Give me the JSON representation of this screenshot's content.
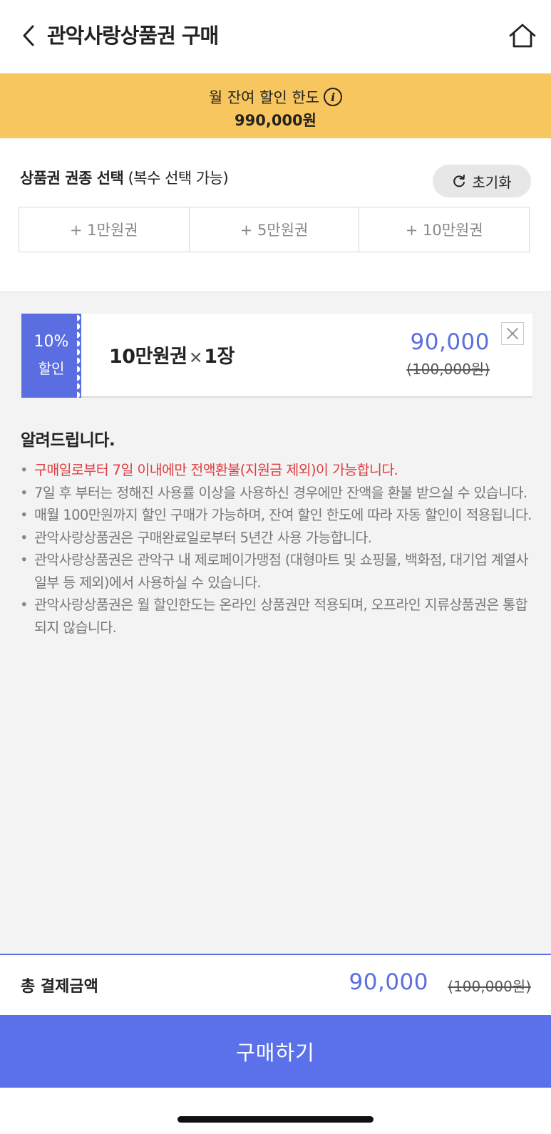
{
  "header": {
    "title": "관악사랑상품권 구매"
  },
  "limit_banner": {
    "label": "월 잔여 할인 한도",
    "amount": "990,000원"
  },
  "voucher_select": {
    "title": "상품권 권종 선택",
    "subtitle": "(복수 선택 가능)",
    "reset_label": "초기화",
    "options": [
      "+ 1만원권",
      "+ 5만원권",
      "+ 10만원권"
    ]
  },
  "cart_item": {
    "discount_percent": "10%",
    "discount_label": "할인",
    "name": "10만원권",
    "multiplier": "×",
    "quantity": "1장",
    "price": "90,000",
    "original_price": "(100,000원)"
  },
  "notice": {
    "title": "알려드립니다.",
    "items": [
      "구매일로부터 7일 이내에만 전액환불(지원금 제외)이 가능합니다.",
      "7일 후 부터는 정해진 사용률 이상을 사용하신 경우에만 잔액을 환불 받으실 수 있습니다.",
      "매월 100만원까지 할인 구매가 가능하며, 잔여 할인 한도에 따라 자동 할인이 적용됩니다.",
      "관악사랑상품권은 구매완료일로부터 5년간 사용 가능합니다.",
      "관악사랑상품권은 관악구 내 제로페이가맹점 (대형마트 및 쇼핑몰, 백화점, 대기업 계열사 일부 등 제외)에서 사용하실 수 있습니다.",
      "관악사랑상품권은 월 할인한도는 온라인 상품권만 적용되며, 오프라인 지류상품권은 통합되지 않습니다."
    ]
  },
  "total": {
    "label": "총 결제금액",
    "price": "90,000",
    "original_price": "(100,000원)"
  },
  "buy_button": {
    "label": "구매하기"
  },
  "colors": {
    "accent": "#5b6ee1",
    "banner": "#f8c65e",
    "alert": "#e03c42"
  },
  "icons": [
    "chevron-left-icon",
    "home-icon",
    "info-icon",
    "refresh-icon",
    "close-icon"
  ]
}
